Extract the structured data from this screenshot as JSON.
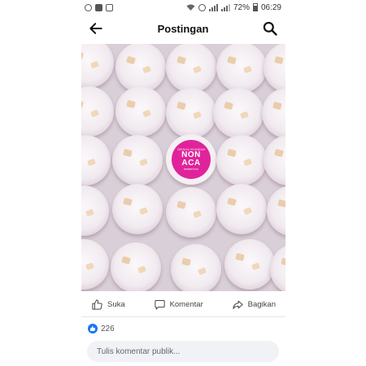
{
  "status_bar": {
    "left_icons": [
      "instagram-icon",
      "flipboard-icon",
      "shop-bag-icon"
    ],
    "right_icons": [
      "wifi-icon",
      "data-saver-icon",
      "signal-icon",
      "signal-icon",
      "battery-icon"
    ],
    "battery": "72%",
    "time": "06:29"
  },
  "header": {
    "title": "Postingan",
    "back_icon": "arrow-left-icon",
    "search_icon": "search-icon"
  },
  "photo": {
    "label_top": "GRAHA NYAMAN",
    "label_main_1": "NON",
    "label_main_2": "ACA",
    "label_bottom": "dessert box"
  },
  "actions": {
    "like": "Suka",
    "comment": "Komentar",
    "share": "Bagikan"
  },
  "reactions": {
    "like_count": "226"
  },
  "comment_input": {
    "placeholder": "Tulis komentar publik..."
  },
  "colors": {
    "accent": "#1877f2",
    "label_pink": "#e0239b"
  }
}
